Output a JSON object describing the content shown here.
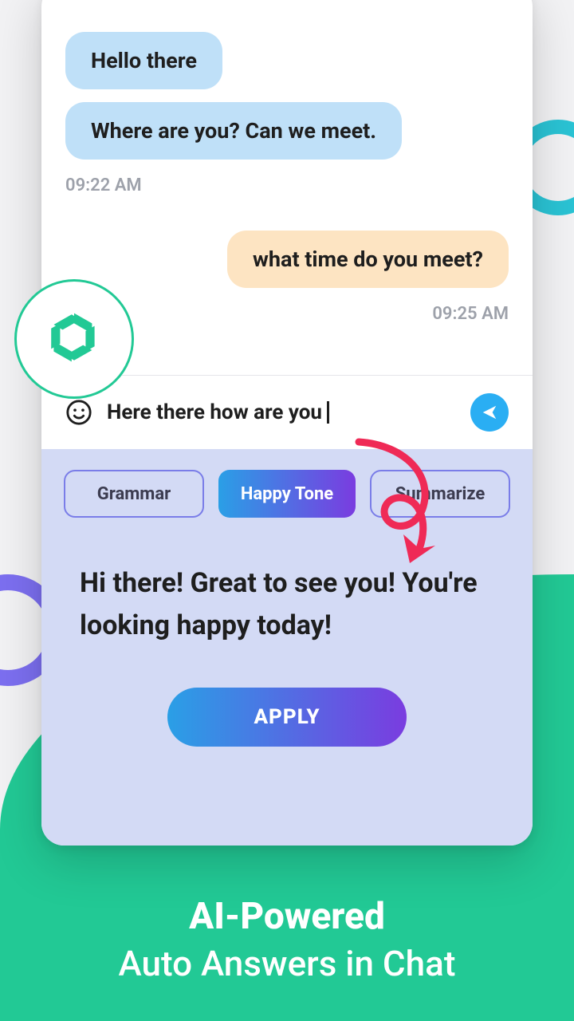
{
  "chat": {
    "msg1": "Hello there",
    "msg2": "Where are you? Can we meet.",
    "time1": "09:22 AM",
    "msg3": "what time do you meet?",
    "time2": "09:25 AM"
  },
  "input": {
    "draft": "Here there how are you"
  },
  "chips": {
    "grammar": "Grammar",
    "happy": "Happy Tone",
    "summarize": "Summarize"
  },
  "suggestion": "Hi there! Great to see you! You're looking happy today!",
  "apply_label": "APPLY",
  "promo": {
    "line1": "AI-Powered",
    "line2": "Auto Answers in Chat"
  }
}
